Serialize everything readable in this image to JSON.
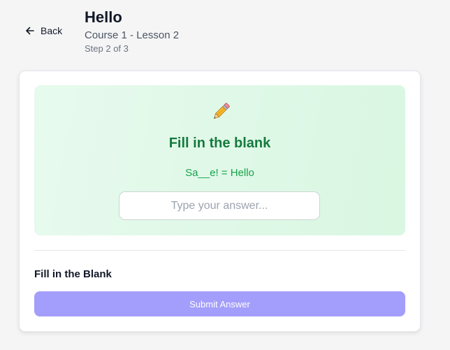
{
  "header": {
    "back_label": "Back",
    "title": "Hello",
    "subtitle": "Course 1 - Lesson 2",
    "step": "Step 2 of 3"
  },
  "exercise": {
    "icon": "pencil-icon",
    "title": "Fill in the blank",
    "prompt": "Sa__e! = Hello",
    "input_placeholder": "Type your answer...",
    "input_value": ""
  },
  "footer": {
    "exercise_type": "Fill in the Blank",
    "submit_label": "Submit Answer"
  },
  "colors": {
    "background": "#f5f5f6",
    "panel_green": "#e2f9e9",
    "title_green": "#157a3d",
    "prompt_green": "#16a34a",
    "submit_purple": "#a39efb"
  }
}
